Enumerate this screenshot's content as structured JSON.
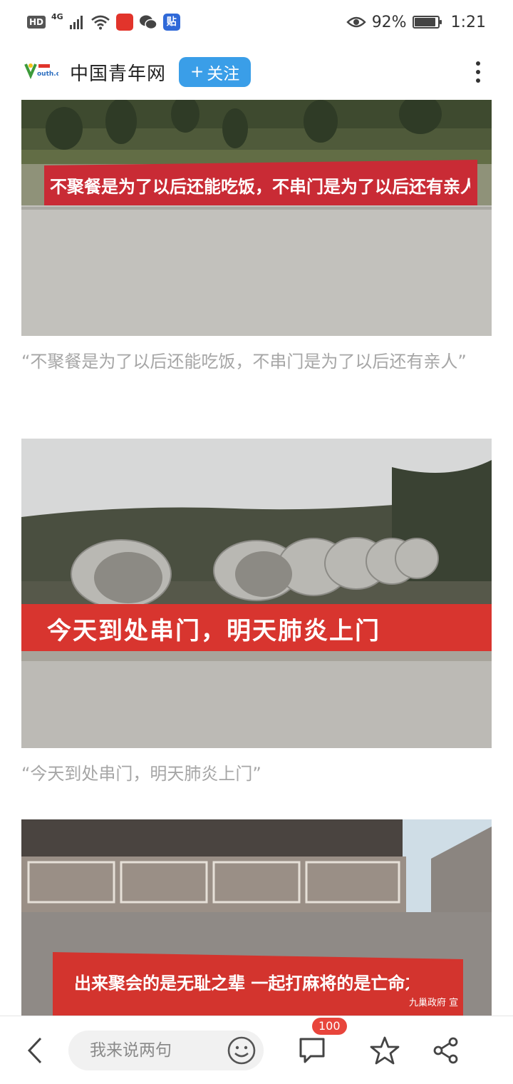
{
  "status_bar": {
    "hd": "HD",
    "network": "4G",
    "app_badge": "贴",
    "battery_percent_text": "92%",
    "battery_level": 0.92,
    "time": "1:21"
  },
  "header": {
    "account_name": "中国青年网",
    "logo_text": "youth.cn",
    "follow_label": "关注",
    "follow_plus": "+",
    "accent": "#3a9ee8"
  },
  "article": {
    "photos": [
      {
        "banner_text": "不聚餐是为了以后还能吃饭，不串门是为了以后还有亲人",
        "caption": "“不聚餐是为了以后还能吃饭，不串门是为了以后还有亲人”"
      },
      {
        "banner_text": "今天到处串门，明天肺炎上门",
        "caption": "“今天到处串门，明天肺炎上门”"
      },
      {
        "banner_text": "出来聚会的是无耻之辈 一起打麻将的是亡命之徒",
        "banner_sign": "九巢政府 宣"
      }
    ]
  },
  "bottom_bar": {
    "comment_placeholder": "我来说两句",
    "comment_count": "100",
    "badge_color": "#e8453c"
  },
  "icons": [
    "back-icon",
    "emoji-icon",
    "comment-icon",
    "star-icon",
    "share-icon",
    "more-icon",
    "eye-icon",
    "wifi-icon",
    "signal-icon"
  ]
}
